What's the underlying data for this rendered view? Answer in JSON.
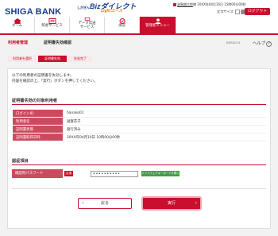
{
  "header": {
    "bank_name": "SHIGA BANK",
    "service_small": "しがぎん",
    "service_name": "Bizダイレクト",
    "service_sub": "Lightコース",
    "user_prefix": "",
    "user_name": "滋賀銀太郎",
    "user_suffix": "様 20XX年04月16日 15時00分00秒",
    "font_size_label": "文字サイズ",
    "logout_label": "ログアウト"
  },
  "nav": [
    {
      "label": "ホーム",
      "icon": "home-icon"
    },
    {
      "label": "照会サービス",
      "icon": "inquiry-icon"
    },
    {
      "label": "データ伝送\nサービス",
      "icon": "data-transfer-icon"
    },
    {
      "label": "承認",
      "icon": "approval-icon"
    },
    {
      "label": "管理者メニュー",
      "icon": "admin-icon"
    }
  ],
  "title": {
    "crumb1": "利用者管理",
    "crumb2": "証明書失効確認",
    "screen_id": "BRSK019",
    "help": "ヘルプ"
  },
  "steps": [
    "利用者を選択",
    "証明書失効",
    "失効完了"
  ],
  "message": {
    "line1": "以下の利用者の証明書を失効します。",
    "line2": "内容を確認の上、「実行」ボタンを押してください。"
  },
  "section1": {
    "title": "証明書失効の対象利用者",
    "rows": [
      {
        "key": "ログインID",
        "value": "hanako01"
      },
      {
        "key": "利用者名",
        "value": "滋賀花子"
      },
      {
        "key": "証明書状態",
        "value": "発行済み"
      },
      {
        "key": "証明書取得日時",
        "value": "20XX年04月10日 10時00分00秒"
      }
    ]
  },
  "section2": {
    "title": "認証項目",
    "password_label": "確認用パスワード",
    "required": "必須",
    "password_value": "••••••••••",
    "soft_keyboard": "ソフトウェアキーボードを開く"
  },
  "buttons": {
    "back": "戻る",
    "execute": "実行"
  },
  "colors": {
    "brand_red": "#c8102e",
    "brand_blue": "#1a3f8f",
    "table_key_bg": "#cc4a5e"
  }
}
